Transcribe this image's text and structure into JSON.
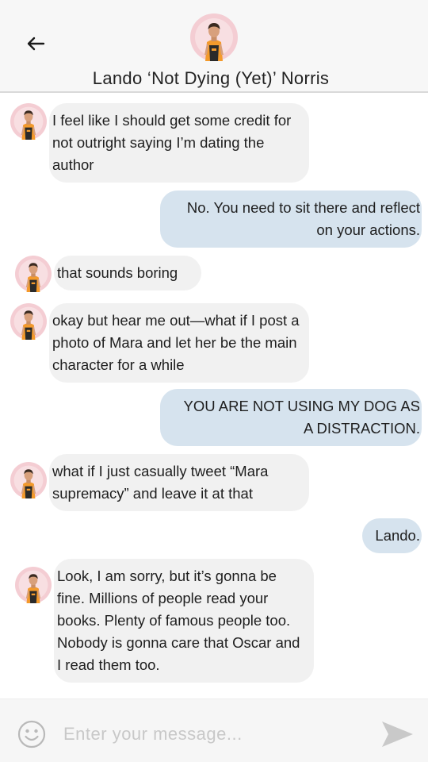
{
  "header": {
    "title": "Lando ‘Not Dying (Yet)’ Norris"
  },
  "messages": [
    {
      "side": "in",
      "text": "I feel like I should get some credit for not outright saying I’m dating the author"
    },
    {
      "side": "out",
      "text": "No. You need to sit there and reflect on your actions."
    },
    {
      "side": "in",
      "text": "that sounds boring"
    },
    {
      "side": "in",
      "text": "okay but hear me out—what if I post a photo of Mara and let her be the main character for a while"
    },
    {
      "side": "out",
      "text": "YOU ARE NOT USING MY DOG AS A DISTRACTION."
    },
    {
      "side": "in",
      "text": "what if I just casually tweet “Mara supremacy” and leave it at that"
    },
    {
      "side": "out",
      "text": "Lando."
    },
    {
      "side": "in",
      "text": "Look, I am sorry, but it’s gonna be fine. Millions of people read your books. Plenty of famous people too. Nobody is gonna care that Oscar and I read them too."
    }
  ],
  "composer": {
    "placeholder": "Enter your message..."
  },
  "colors": {
    "incoming_bubble": "#f1f1f1",
    "outgoing_bubble": "#d6e3ee",
    "avatar_ring": "#f2c9cf",
    "jersey_orange": "#f39a2c"
  },
  "icons": {
    "back": "arrow-left-icon",
    "emoji": "smiley-icon",
    "send": "send-icon"
  }
}
